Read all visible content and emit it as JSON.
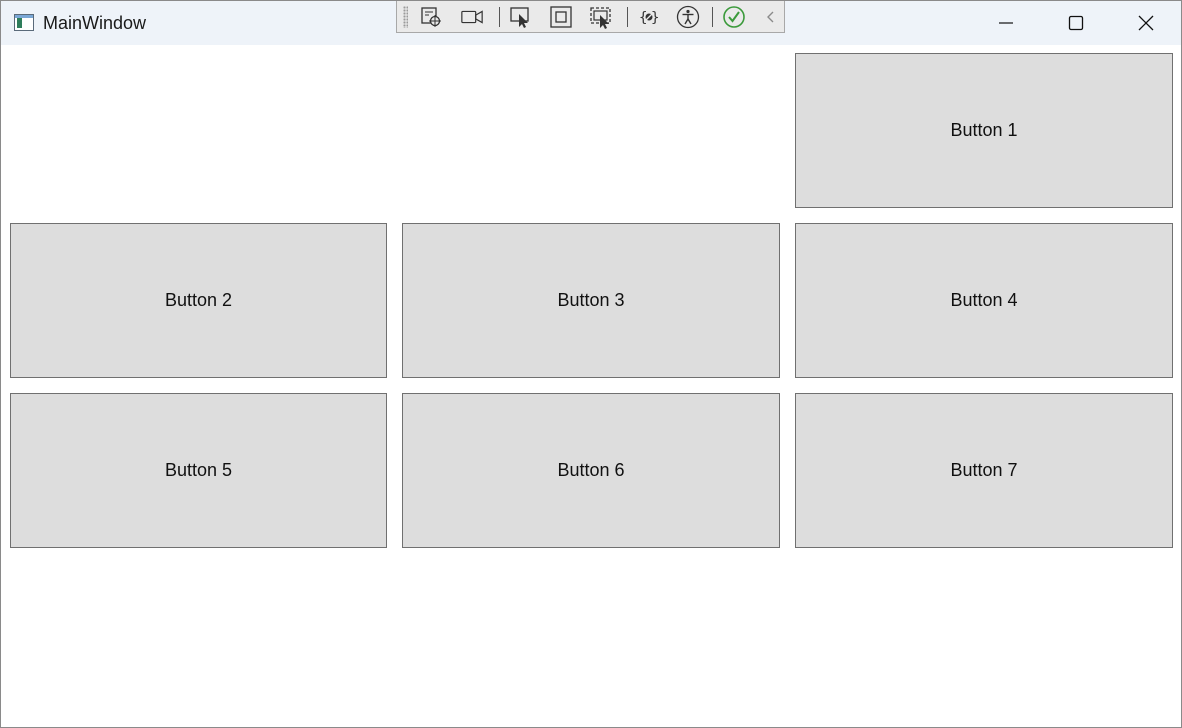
{
  "window": {
    "title": "MainWindow"
  },
  "caption_buttons": [
    {
      "name": "minimize-button",
      "icon": "minimize-icon"
    },
    {
      "name": "maximize-button",
      "icon": "maximize-icon"
    },
    {
      "name": "close-button",
      "icon": "close-icon"
    }
  ],
  "debug_toolbar": {
    "items": [
      "go-to-live-visual-tree-icon",
      "record-icon",
      "select-element-icon",
      "display-layout-adorners-icon",
      "track-focused-element-icon",
      "binding-failures-icon",
      "accessibility-icon",
      "check-icon",
      "collapse-chevron-icon"
    ],
    "check_color": "#3b9a3b"
  },
  "buttons": [
    {
      "label": "Button 1"
    },
    {
      "label": "Button 2"
    },
    {
      "label": "Button 3"
    },
    {
      "label": "Button 4"
    },
    {
      "label": "Button 5"
    },
    {
      "label": "Button 6"
    },
    {
      "label": "Button 7"
    }
  ]
}
